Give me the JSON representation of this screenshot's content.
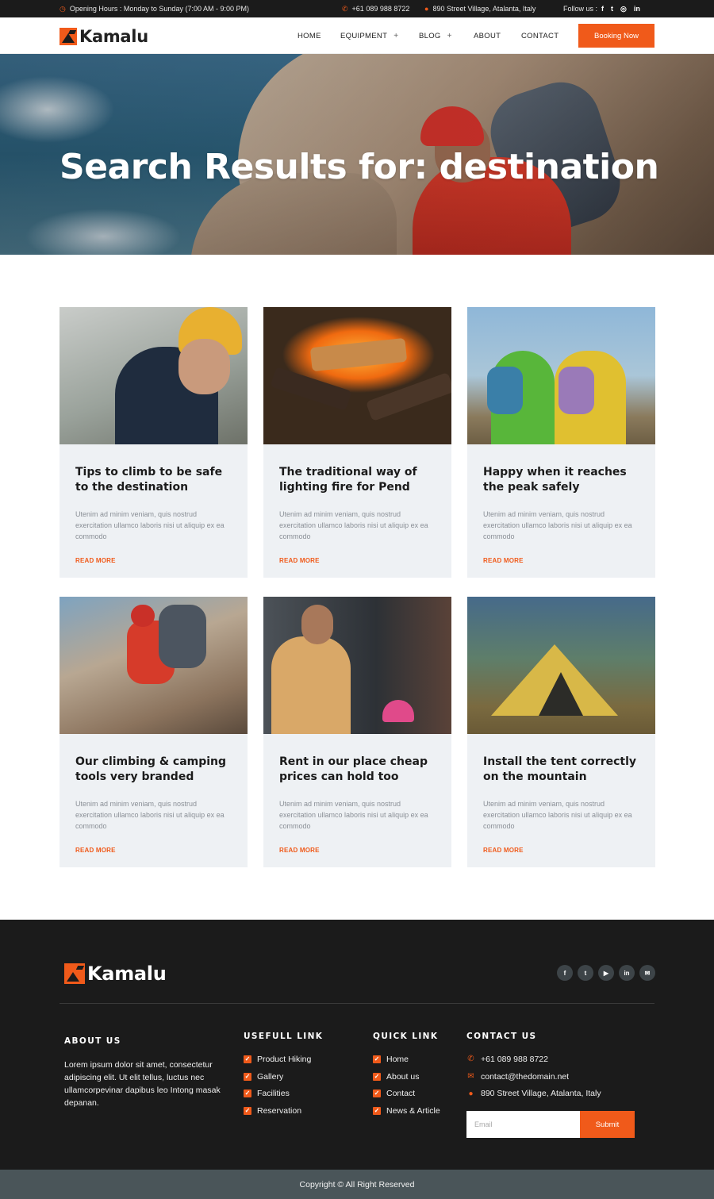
{
  "topbar": {
    "hours": "Opening Hours : Monday to Sunday (7:00 AM - 9:00 PM)",
    "phone": "+61 089 988 8722",
    "address": "890 Street Village, Atalanta, Italy",
    "follow_label": "Follow us :",
    "social": [
      "facebook-icon",
      "twitter-icon",
      "instagram-icon",
      "linkedin-icon"
    ]
  },
  "header": {
    "brand": "Kamalu",
    "nav": [
      {
        "label": "HOME"
      },
      {
        "label": "EQUIPMENT",
        "plus": "+"
      },
      {
        "label": "BLOG",
        "plus": "+"
      },
      {
        "label": "ABOUT"
      },
      {
        "label": "CONTACT"
      }
    ],
    "cta": "Booking Now"
  },
  "hero": {
    "title": "Search Results for: destination"
  },
  "posts": [
    {
      "title": "Tips to climb to be safe to the destination",
      "excerpt": "Utenim ad minim veniam, quis nostrud exercitation ullamco laboris nisi ut aliquip ex ea commodo",
      "more": "READ MORE",
      "image": "hiker-yellow-beanie"
    },
    {
      "title": "The traditional way of lighting fire for Pend",
      "excerpt": "Utenim ad minim veniam, quis nostrud exercitation ullamco laboris nisi ut aliquip ex ea commodo",
      "more": "READ MORE",
      "image": "campfire"
    },
    {
      "title": "Happy when it reaches the peak safely",
      "excerpt": "Utenim ad minim veniam, quis nostrud exercitation ullamco laboris nisi ut aliquip ex ea commodo",
      "more": "READ MORE",
      "image": "hikers-on-peak"
    },
    {
      "title": "Our climbing & camping tools very branded",
      "excerpt": "Utenim ad minim veniam, quis nostrud exercitation ullamco laboris nisi ut aliquip ex ea commodo",
      "more": "READ MORE",
      "image": "climber-on-rock"
    },
    {
      "title": "Rent in our place cheap prices can hold too",
      "excerpt": "Utenim ad minim veniam, quis nostrud exercitation ullamco laboris nisi ut aliquip ex ea commodo",
      "more": "READ MORE",
      "image": "gear-shop"
    },
    {
      "title": "Install the tent correctly on the mountain",
      "excerpt": "Utenim ad minim veniam, quis nostrud exercitation ullamco laboris nisi ut aliquip ex ea commodo",
      "more": "READ MORE",
      "image": "yellow-tent"
    }
  ],
  "footer": {
    "brand": "Kamalu",
    "social": [
      "facebook-icon",
      "twitter-icon",
      "youtube-icon",
      "linkedin-icon",
      "email-icon"
    ],
    "about": {
      "heading": "ABOUT US",
      "text": "Lorem ipsum dolor sit amet, consectetur adipiscing elit. Ut elit tellus, luctus nec ullamcorpevinar dapibus leo Intong masak depanan."
    },
    "useful": {
      "heading": "USEFULL LINK",
      "links": [
        "Product Hiking",
        "Gallery",
        "Facilities",
        "Reservation"
      ]
    },
    "quick": {
      "heading": "QUICK LINK",
      "links": [
        "Home",
        "About us",
        "Contact",
        "News & Article"
      ]
    },
    "contact": {
      "heading": "CONTACT US",
      "phone": "+61 089 988 8722",
      "email": "contact@thedomain.net",
      "address": "890 Street Village, Atalanta, Italy",
      "email_placeholder": "Email",
      "submit": "Submit"
    },
    "copyright": "Copyright © All Right Reserved"
  },
  "colors": {
    "accent": "#f05a1a",
    "dark": "#1b1b1b",
    "card_bg": "#eef1f4",
    "copyright_bg": "#4a5559"
  }
}
